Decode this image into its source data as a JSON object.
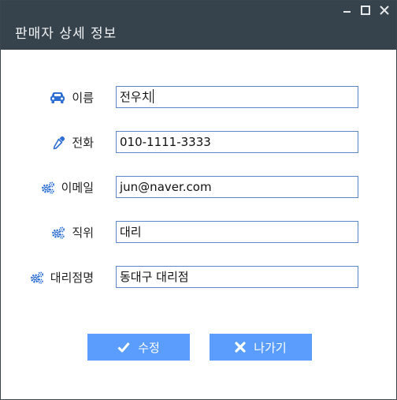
{
  "window": {
    "title": "판매자 상세 정보",
    "controls": {
      "minimize_icon": "minimize-icon",
      "maximize_icon": "maximize-icon",
      "close_icon": "close-icon"
    }
  },
  "form": {
    "name": {
      "label": "이름",
      "value": "전우치",
      "icon": "car-icon"
    },
    "phone": {
      "label": "전화",
      "value": "010-1111-3333",
      "icon": "eyedropper-icon"
    },
    "email": {
      "label": "이메일",
      "value": "jun@naver.com",
      "icon": "gears-icon"
    },
    "position": {
      "label": "직위",
      "value": "대리",
      "icon": "gears-icon"
    },
    "branch": {
      "label": "대리점명",
      "value": "동대구 대리점",
      "icon": "gears-icon"
    }
  },
  "buttons": {
    "edit": {
      "label": "수정",
      "icon": "check-icon"
    },
    "exit": {
      "label": "나가기",
      "icon": "times-icon"
    }
  },
  "colors": {
    "titlebar": "#36434d",
    "icon": "#2d6fd3",
    "button": "#5b9dfc",
    "input_border": "#5d86c7"
  }
}
